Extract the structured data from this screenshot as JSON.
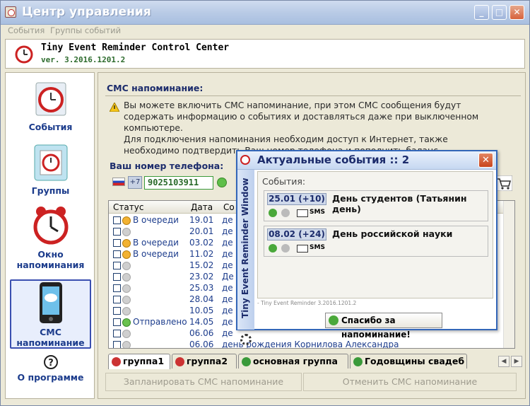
{
  "window": {
    "title": "Центр управления"
  },
  "menu": [
    "События",
    "Группы событий"
  ],
  "header": {
    "name": "Tiny Event Reminder Control Center",
    "version": "ver. 3.2016.1201.2"
  },
  "sidebar": [
    {
      "label": "События",
      "icon": "calendar-clock-icon"
    },
    {
      "label": "Группы",
      "icon": "groups-folder-icon"
    },
    {
      "label": "Окно напоминания",
      "icon": "alarm-clock-icon"
    },
    {
      "label": "СМС напоминание",
      "icon": "mobile-phone-icon"
    },
    {
      "label": "О программе",
      "icon": "help-icon"
    }
  ],
  "panel": {
    "title": "СМС напоминание:",
    "info1": "Вы можете включить СМС напоминание, при этом СМС сообщения будут содержать информацию о событиях и доставляться даже при выключенном компьютере.",
    "info2": "Для подключения напоминания необходим доступ к Интернет, также необходимо подтвердить Ваш номер телефона и пополнить баланс",
    "phone_label": "Ваш номер телефона:",
    "country_code": "+7",
    "phone": "9025103911"
  },
  "table": {
    "headers": [
      "Статус",
      "Дата",
      "Со"
    ],
    "rows": [
      {
        "status": "В очереди",
        "state": "queued",
        "date": "19.01",
        "desc": "де"
      },
      {
        "status": "",
        "state": "none",
        "date": "20.01",
        "desc": "де"
      },
      {
        "status": "В очереди",
        "state": "queued",
        "date": "03.02",
        "desc": "де"
      },
      {
        "status": "В очереди",
        "state": "queued",
        "date": "11.02",
        "desc": "де"
      },
      {
        "status": "",
        "state": "none",
        "date": "15.02",
        "desc": "де"
      },
      {
        "status": "",
        "state": "none",
        "date": "23.02",
        "desc": "Де"
      },
      {
        "status": "",
        "state": "none",
        "date": "25.03",
        "desc": "де"
      },
      {
        "status": "",
        "state": "none",
        "date": "28.04",
        "desc": "де"
      },
      {
        "status": "",
        "state": "none",
        "date": "10.05",
        "desc": "де"
      },
      {
        "status": "Отправлено",
        "state": "sent",
        "date": "14.05",
        "desc": "де"
      },
      {
        "status": "",
        "state": "none",
        "date": "06.06",
        "desc": "де"
      },
      {
        "status": "",
        "state": "none",
        "date": "06.06",
        "desc": "день рождения Корнилова Александра"
      }
    ]
  },
  "tabs": [
    "группа1",
    "группа2",
    "основная группа",
    "Годовщины свадеб"
  ],
  "buttons": {
    "schedule": "Запланировать СМС напоминание",
    "cancel": "Отменить СМС напоминание"
  },
  "popup": {
    "title": "Актуальные события :: 2",
    "side": "Tiny Event Reminder Window",
    "label": "События:",
    "events": [
      {
        "date": "25.01 (+10)",
        "name": "День студентов (Татьянин день)"
      },
      {
        "date": "08.02 (+24)",
        "name": "День российской науки"
      }
    ],
    "sms": "SMS",
    "footer": "- Tiny Event Reminder 3.2016.1201.2",
    "thanks": "Спасибо за напоминание!"
  }
}
